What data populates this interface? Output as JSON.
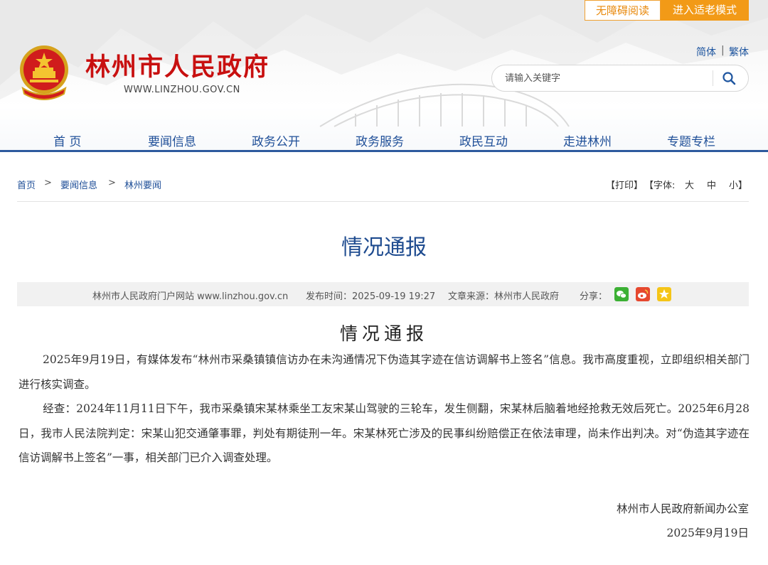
{
  "accessibility": {
    "reader_label": "无障碍阅读",
    "elder_mode_label": "进入适老模式"
  },
  "site": {
    "title": "林州市人民政府",
    "url": "WWW.LINZHOU.GOV.CN"
  },
  "language": {
    "simplified": "简体",
    "separator": "|",
    "traditional": "繁体"
  },
  "search": {
    "placeholder": "请输入关键字"
  },
  "nav": [
    "首 页",
    "要闻信息",
    "政务公开",
    "政务服务",
    "政民互动",
    "走进林州",
    "专题专栏"
  ],
  "breadcrumb": {
    "items": [
      "首页",
      "要闻信息",
      "林州要闻"
    ],
    "separator": ">"
  },
  "tools": {
    "print": "【打印】",
    "font_label": "【字体:",
    "large": "大",
    "medium": "中",
    "small": "小】"
  },
  "article": {
    "title": "情况通报",
    "meta": {
      "source_site": "林州市人民政府门户网站 www.linzhou.gov.cn",
      "publish_time": "发布时间：2025-09-19 19:27",
      "article_source": "文章来源：林州市人民政府",
      "share_label": "分享："
    },
    "share_icons": [
      "wechat-icon",
      "weibo-icon",
      "favorite-icon"
    ],
    "heading": "情况通报",
    "paragraphs": [
      "2025年9月19日，有媒体发布“林州市采桑镇镇信访办在未沟通情况下伪造其字迹在信访调解书上签名”信息。我市高度重视，立即组织相关部门进行核实调查。",
      "经查：2024年11月11日下午，我市采桑镇宋某林乘坐工友宋某山驾驶的三轮车，发生侧翻，宋某林后脑着地经抢救无效后死亡。2025年6月28日，我市人民法院判定：宋某山犯交通肇事罪，判处有期徒刑一年。宋某林死亡涉及的民事纠纷赔偿正在依法审理，尚未作出判决。对“伪造其字迹在信访调解书上签名”一事，相关部门已介入调查处理。"
    ],
    "signature": "林州市人民政府新闻办公室",
    "date": "2025年9月19日"
  },
  "colors": {
    "nav_blue": "#1f4f98",
    "title_red": "#c81010",
    "accent_orange": "#f29a17",
    "header_line": "#2d5a9e"
  }
}
